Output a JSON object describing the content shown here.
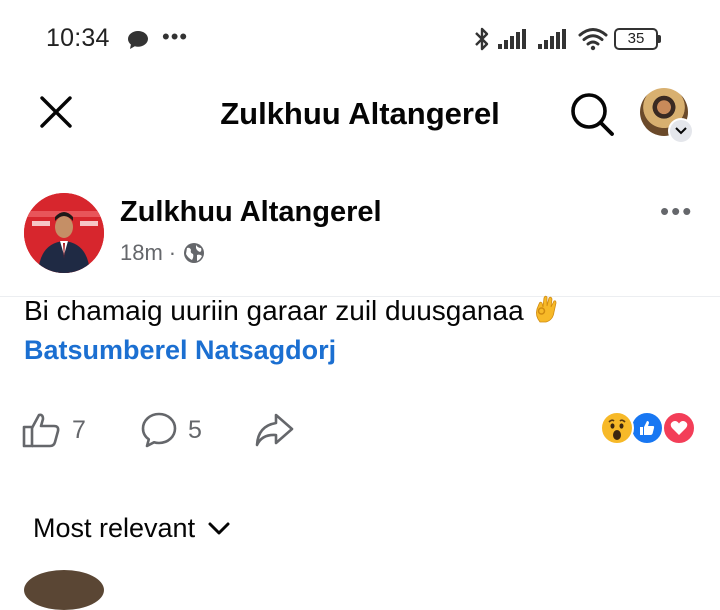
{
  "status_bar": {
    "time": "10:34",
    "more": "•••",
    "battery": "35"
  },
  "header": {
    "title": "Zulkhuu Altangerel"
  },
  "post": {
    "author": "Zulkhuu Altangerel",
    "time": "18m",
    "separator": "·",
    "text": "Bi chamaig uuriin garaar zuil duusganaa",
    "mention": "Batsumberel Natsagdorj",
    "like_count": "7",
    "comment_count": "5",
    "more": "•••"
  },
  "comments": {
    "sort_label": "Most relevant"
  },
  "colors": {
    "link_blue": "#1b6fd1",
    "muted": "#65676b",
    "like_blue": "#1877f2",
    "love_red": "#f33e58",
    "wow_yellow": "#f7b928"
  }
}
